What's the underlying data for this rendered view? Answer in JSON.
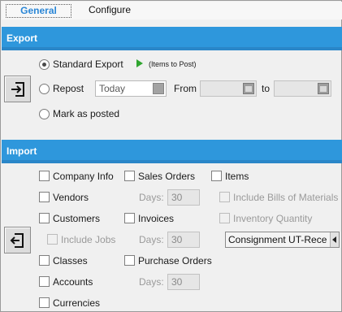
{
  "tabs": {
    "general": "General",
    "configure": "Configure"
  },
  "export": {
    "header": "Export",
    "standard_export": "Standard Export",
    "items_to_post": "(Items to Post)",
    "repost": "Repost",
    "repost_date": "Today",
    "from_label": "From",
    "from_value": "",
    "to_label": "to",
    "to_value": "",
    "mark_as_posted": "Mark as posted"
  },
  "import": {
    "header": "Import",
    "company_info": "Company Info",
    "sales_orders": "Sales Orders",
    "items": "Items",
    "vendors": "Vendors",
    "days_label": "Days:",
    "sales_orders_days": "30",
    "include_bills": "Include Bills of Materials",
    "customers": "Customers",
    "invoices": "Invoices",
    "inventory_quantity": "Inventory Quantity",
    "include_jobs": "Include Jobs",
    "invoices_days": "30",
    "consignment": "Consignment UT-Rece",
    "classes": "Classes",
    "purchase_orders": "Purchase Orders",
    "accounts": "Accounts",
    "purchase_orders_days": "30",
    "currencies": "Currencies"
  },
  "colors": {
    "header_blue": "#2e97dc",
    "tab_active": "#2a86d6",
    "play_green": "#2fa52f"
  },
  "icons": {
    "export": "export-arrow-icon",
    "import": "import-arrow-icon",
    "play": "play-icon"
  }
}
